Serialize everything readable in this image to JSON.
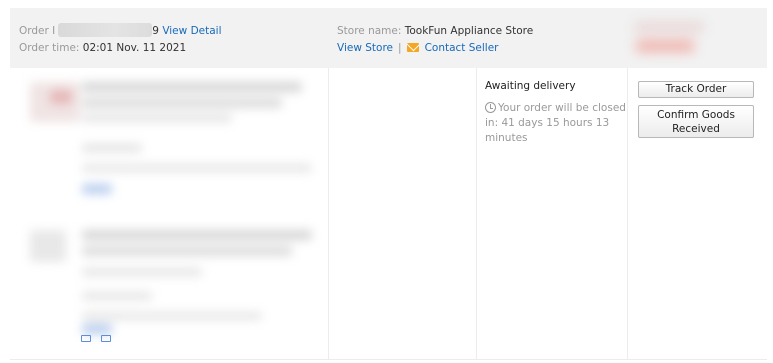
{
  "order": {
    "id_label": "Order I",
    "id_tail": "9",
    "view_detail": "View Detail",
    "time_label": "Order time:",
    "time_value": "02:01 Nov. 11 2021"
  },
  "store": {
    "name_label": "Store name:",
    "name_value": "TookFun Appliance Store",
    "view_store": "View Store",
    "separator": "|",
    "contact_seller": "Contact Seller"
  },
  "status": {
    "state": "Awaiting delivery",
    "countdown": "Your order will be closed in: 41 days 15 hours 13 minutes"
  },
  "actions": {
    "track_order": "Track Order",
    "confirm_goods": "Confirm Goods Received"
  },
  "icons": {
    "mail": "mail-icon",
    "clock": "clock-icon"
  },
  "colors": {
    "link": "#1769b8",
    "header_bg": "#f2f2f2",
    "mail_icon": "#f5a623"
  }
}
